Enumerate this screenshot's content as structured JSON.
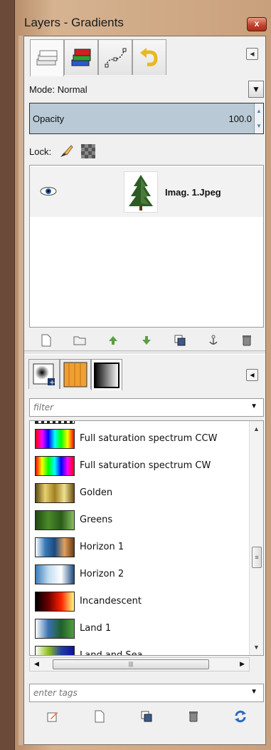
{
  "window": {
    "title": "Layers - Gradients",
    "close_label": "x"
  },
  "layers_tabs": [
    {
      "icon": "layers-icon"
    },
    {
      "icon": "channels-icon"
    },
    {
      "icon": "paths-icon"
    },
    {
      "icon": "undo-history-icon"
    }
  ],
  "mode": {
    "label": "Mode: Normal"
  },
  "opacity": {
    "label": "Opacity",
    "value": "100.0"
  },
  "lock": {
    "label": "Lock:"
  },
  "layers": [
    {
      "name": "Imag. 1.Jpeg",
      "visible": true
    }
  ],
  "layer_toolbar": [
    "new-layer-icon",
    "new-layer-group-icon",
    "raise-layer-icon",
    "lower-layer-icon",
    "duplicate-layer-icon",
    "anchor-layer-icon",
    "delete-layer-icon"
  ],
  "gradient_tabs": [
    {
      "icon": "brushes-icon"
    },
    {
      "icon": "patterns-icon"
    },
    {
      "icon": "gradients-icon"
    }
  ],
  "filter": {
    "placeholder": "filter"
  },
  "gradients": [
    {
      "name": "Full saturation spectrum CCW",
      "colors": [
        "#ff0000",
        "#ff00ff",
        "#0000ff",
        "#00ffff",
        "#00ff00",
        "#ffff00",
        "#ff0000"
      ]
    },
    {
      "name": "Full saturation spectrum CW",
      "colors": [
        "#ff0000",
        "#ffff00",
        "#00ff00",
        "#00ffff",
        "#0000ff",
        "#ff00ff",
        "#ff0000"
      ]
    },
    {
      "name": "Golden",
      "colors": [
        "#5a4a10",
        "#e8d070",
        "#a08020",
        "#f0e090",
        "#6a5010"
      ]
    },
    {
      "name": "Greens",
      "colors": [
        "#1e4a10",
        "#4c8a2a",
        "#2a5a18",
        "#8ac060"
      ]
    },
    {
      "name": "Horizon 1",
      "colors": [
        "#ffffff",
        "#3a7ab8",
        "#1a4a80",
        "#e0a060",
        "#6a3a10"
      ]
    },
    {
      "name": "Horizon 2",
      "colors": [
        "#3a7ab8",
        "#c0dcf0",
        "#ffffff",
        "#1a4a80"
      ]
    },
    {
      "name": "Incandescent",
      "colors": [
        "#000000",
        "#6a0000",
        "#ff2000",
        "#ffff80"
      ]
    },
    {
      "name": "Land 1",
      "colors": [
        "#ffffff",
        "#3a70b0",
        "#20602a",
        "#50a040"
      ]
    },
    {
      "name": "Land and Sea",
      "colors": [
        "#ffffff",
        "#90c020",
        "#2040a0",
        "#1010a0"
      ]
    }
  ],
  "tags": {
    "placeholder": "enter tags"
  },
  "gradient_toolbar": [
    "edit-gradient-icon",
    "new-gradient-icon",
    "duplicate-gradient-icon",
    "delete-gradient-icon",
    "refresh-gradients-icon"
  ]
}
